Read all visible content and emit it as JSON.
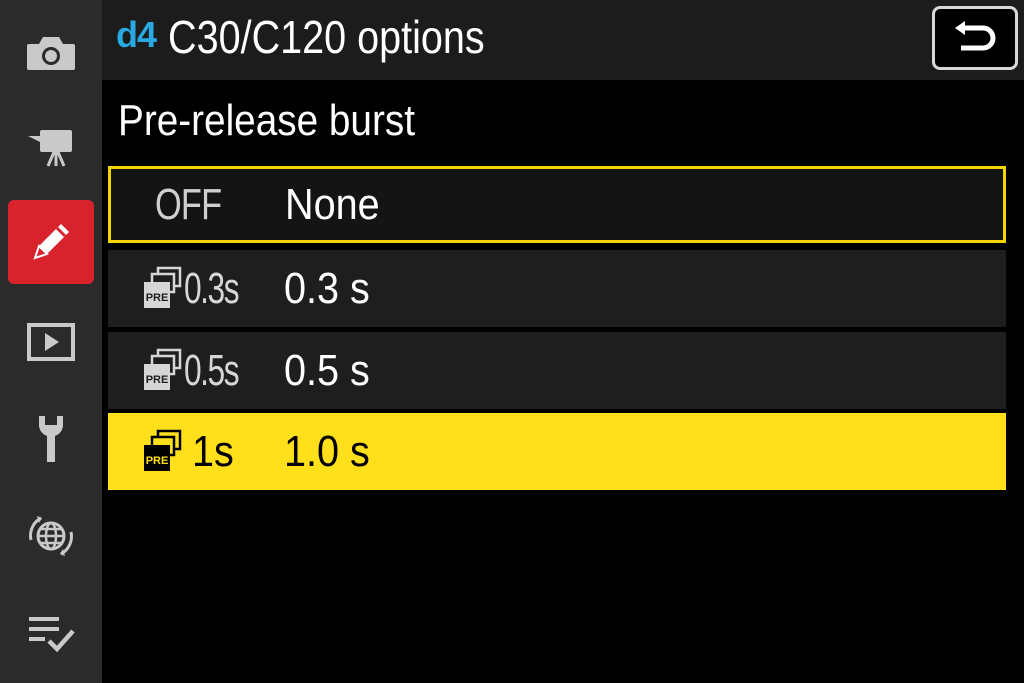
{
  "sidebar": {
    "items": [
      {
        "icon": "camera-icon",
        "active": false
      },
      {
        "icon": "movie-camera-icon",
        "active": false
      },
      {
        "icon": "pencil-icon",
        "active": true
      },
      {
        "icon": "playback-icon",
        "active": false
      },
      {
        "icon": "wrench-icon",
        "active": false
      },
      {
        "icon": "network-icon",
        "active": false
      },
      {
        "icon": "my-menu-icon",
        "active": false
      }
    ]
  },
  "header": {
    "section_code": "d4",
    "title": "C30/C120 options",
    "back_icon": "return-icon"
  },
  "subtitle": "Pre-release burst",
  "options": [
    {
      "code": "OFF",
      "label": "None",
      "icon": null,
      "state": "focused"
    },
    {
      "code": "0.3s",
      "label": "0.3 s",
      "icon": "pre-burst-icon",
      "state": "normal"
    },
    {
      "code": "0.5s",
      "label": "0.5 s",
      "icon": "pre-burst-icon",
      "state": "normal"
    },
    {
      "code": "1s",
      "label": "1.0 s",
      "icon": "pre-burst-icon",
      "state": "selected"
    }
  ],
  "colors": {
    "accent_yellow": "#ffe01b",
    "active_red": "#d9232c",
    "section_blue": "#29a9e1"
  }
}
